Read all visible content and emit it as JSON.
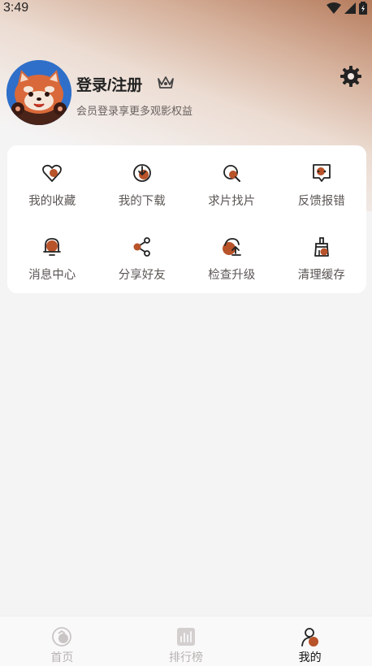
{
  "status_bar": {
    "time": "3:49"
  },
  "profile": {
    "title": "登录/注册",
    "subtitle": "会员登录享更多观影权益"
  },
  "menu": [
    {
      "label": "我的收藏",
      "icon": "heart-icon"
    },
    {
      "label": "我的下载",
      "icon": "download-icon"
    },
    {
      "label": "求片找片",
      "icon": "search-film-icon"
    },
    {
      "label": "反馈报错",
      "icon": "feedback-icon"
    },
    {
      "label": "消息中心",
      "icon": "bell-icon"
    },
    {
      "label": "分享好友",
      "icon": "share-icon"
    },
    {
      "label": "检查升级",
      "icon": "upgrade-icon"
    },
    {
      "label": "清理缓存",
      "icon": "broom-icon"
    }
  ],
  "bottom_nav": [
    {
      "label": "首页",
      "icon": "home-icon",
      "active": false
    },
    {
      "label": "排行榜",
      "icon": "ranking-icon",
      "active": false
    },
    {
      "label": "我的",
      "icon": "profile-icon",
      "active": true
    }
  ],
  "colors": {
    "accent": "#b8532a",
    "icon_stroke": "#222222",
    "inactive": "#b7b3b2"
  }
}
